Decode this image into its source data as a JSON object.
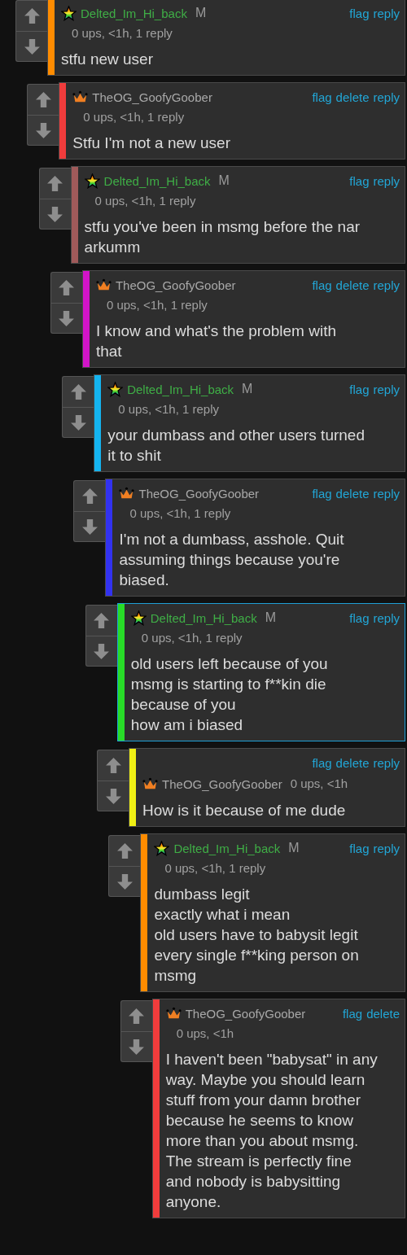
{
  "comments": [
    {
      "user": "Delted_Im_Hi_back",
      "kind": "star",
      "tag": "M",
      "actions_on_top": false,
      "color": "#ff8c00",
      "highlighted": false,
      "actions": [
        "flag",
        "reply"
      ],
      "meta": "0 ups, <1h, 1 reply",
      "lines": [
        "stfu new user"
      ],
      "replies": [
        {
          "user": "TheOG_GoofyGoober",
          "kind": "crown",
          "actions_on_top": false,
          "color": "#f03c3c",
          "highlighted": false,
          "actions": [
            "flag",
            "delete",
            "reply"
          ],
          "meta": "0 ups, <1h, 1 reply",
          "lines": [
            "Stfu I'm not a new user"
          ],
          "replies": [
            {
              "user": "Delted_Im_Hi_back",
              "kind": "star",
              "tag": "M",
              "actions_on_top": false,
              "color": "#a05a5a",
              "highlighted": false,
              "actions": [
                "flag",
                "reply"
              ],
              "meta": "0 ups, <1h, 1 reply",
              "lines": [
                "stfu you've been in msmg before the nar",
                "arkumm"
              ],
              "replies": [
                {
                  "user": "TheOG_GoofyGoober",
                  "kind": "crown",
                  "actions_on_top": false,
                  "color": "#d214c8",
                  "highlighted": false,
                  "actions": [
                    "flag",
                    "delete",
                    "reply"
                  ],
                  "meta": "0 ups, <1h, 1 reply",
                  "lines": [
                    "I know and what's the problem with",
                    "that"
                  ],
                  "replies": [
                    {
                      "user": "Delted_Im_Hi_back",
                      "kind": "star",
                      "tag": "M",
                      "actions_on_top": false,
                      "color": "#14b4f0",
                      "highlighted": false,
                      "actions": [
                        "flag",
                        "reply"
                      ],
                      "meta": "0 ups, <1h, 1 reply",
                      "lines": [
                        "your dumbass and other users turned",
                        "it to shit"
                      ],
                      "replies": [
                        {
                          "user": "TheOG_GoofyGoober",
                          "kind": "crown",
                          "actions_on_top": false,
                          "color": "#3232f0",
                          "highlighted": false,
                          "actions": [
                            "flag",
                            "delete",
                            "reply"
                          ],
                          "meta": "0 ups, <1h, 1 reply",
                          "lines": [
                            "I'm not a dumbass, asshole. Quit",
                            "assuming things because you're",
                            "biased."
                          ],
                          "replies": [
                            {
                              "user": "Delted_Im_Hi_back",
                              "kind": "star",
                              "tag": "M",
                              "actions_on_top": false,
                              "color": "#28dc28",
                              "highlighted": true,
                              "actions": [
                                "flag",
                                "reply"
                              ],
                              "meta": "0 ups, <1h, 1 reply",
                              "lines": [
                                "old users left because of you",
                                "msmg is starting to f**kin die",
                                "because of you",
                                "how am i biased"
                              ],
                              "replies": [
                                {
                                  "user": "TheOG_GoofyGoober",
                                  "kind": "crown",
                                  "actions_on_top": true,
                                  "color": "#f0f014",
                                  "highlighted": false,
                                  "actions": [
                                    "flag",
                                    "delete",
                                    "reply"
                                  ],
                                  "meta": "0 ups, <1h",
                                  "lines": [
                                    "How is it because of me dude"
                                  ],
                                  "replies": [
                                    {
                                      "user": "Delted_Im_Hi_back",
                                      "kind": "star",
                                      "tag": "M",
                                      "actions_on_top": false,
                                      "color": "#ff8c00",
                                      "highlighted": false,
                                      "actions": [
                                        "flag",
                                        "reply"
                                      ],
                                      "meta": "0 ups, <1h, 1 reply",
                                      "lines": [
                                        "dumbass legit",
                                        "exactly what i mean",
                                        "old users have to babysit legit",
                                        "every single f**king person on",
                                        "msmg"
                                      ],
                                      "replies": [
                                        {
                                          "user": "TheOG_GoofyGoober",
                                          "kind": "crown",
                                          "actions_on_top": false,
                                          "color": "#f03c3c",
                                          "highlighted": false,
                                          "actions": [
                                            "flag",
                                            "delete"
                                          ],
                                          "meta": "0 ups, <1h",
                                          "lines": [
                                            "I haven't been \"babysat\" in any",
                                            "way. Maybe you should learn",
                                            "stuff from your damn brother",
                                            "because he seems to know",
                                            "more than you about msmg.",
                                            "The stream is perfectly fine",
                                            "and nobody is babysitting",
                                            "anyone."
                                          ]
                                        }
                                      ]
                                    }
                                  ]
                                }
                              ]
                            }
                          ]
                        }
                      ]
                    }
                  ]
                }
              ]
            }
          ]
        }
      ]
    }
  ]
}
